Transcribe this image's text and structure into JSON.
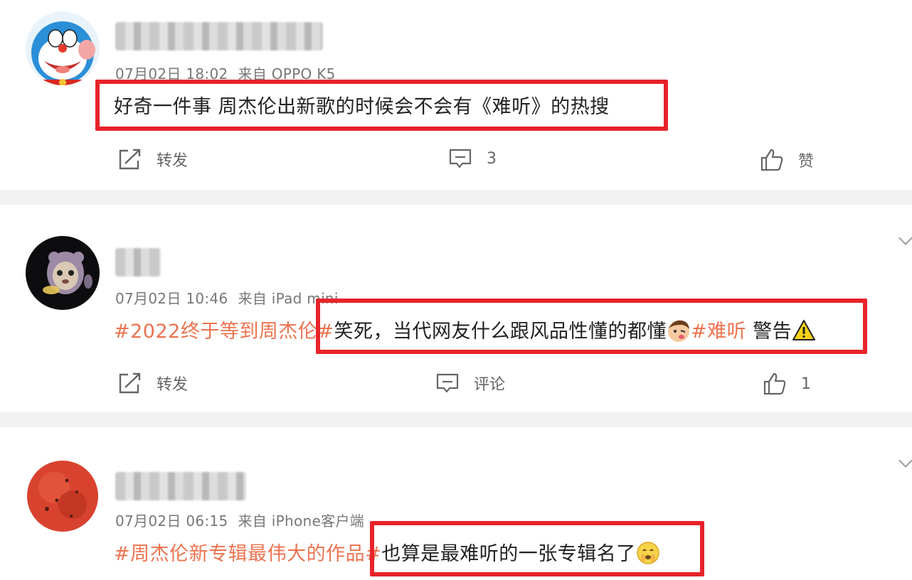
{
  "posts": [
    {
      "timestamp": "07月02日 18:02",
      "source": "来自 OPPO K5",
      "topic": "",
      "text": "好奇一件事 周杰伦出新歌的时候会不会有《难听》的热搜",
      "actions": {
        "repost": "转发",
        "comment": "3",
        "like": "赞"
      }
    },
    {
      "timestamp": "07月02日 10:46",
      "source": "来自 iPad mini",
      "topic": "#2022终于等到周杰伦#",
      "text": "笑死，当代网友什么跟风品性懂的都懂",
      "tag": "#难听",
      "tail_text": "警告",
      "actions": {
        "repost": "转发",
        "comment": "评论",
        "like": "1"
      }
    },
    {
      "timestamp": "07月02日 06:15",
      "source": "来自 iPhone客户端",
      "topic": "#周杰伦新专辑最伟大的作品#",
      "text": "也算是最难听的一张专辑名了"
    }
  ],
  "icons": [
    "repost-icon",
    "comment-icon",
    "like-icon",
    "more-chevron-icon",
    "warning-icon",
    "cheeky-emoji-icon",
    "hush-emoji-icon"
  ],
  "colors": {
    "highlight": "#e8232a",
    "topic": "#eb7350",
    "divider": "#f2f2f2"
  }
}
